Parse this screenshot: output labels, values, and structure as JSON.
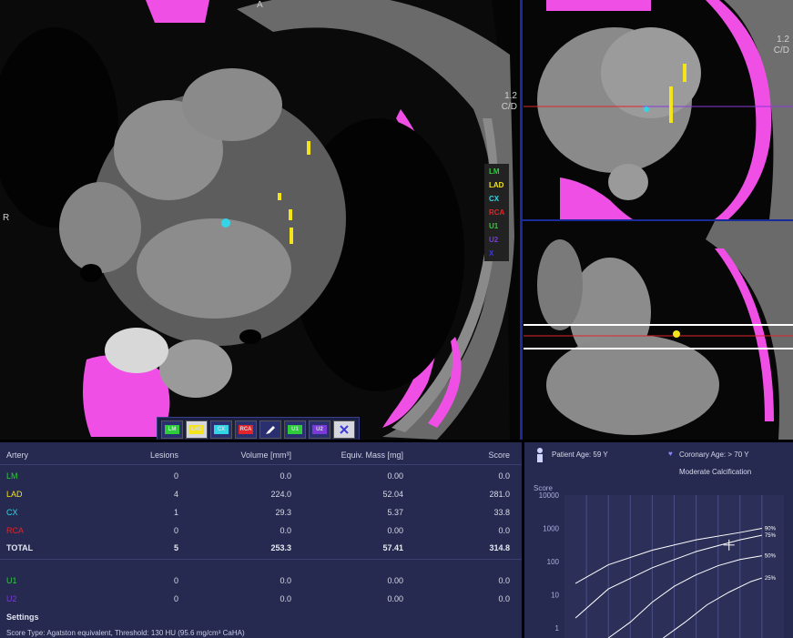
{
  "viewports": {
    "axial": {
      "orientation_left": "R",
      "orientation_top": "A",
      "zoom": "1.2",
      "window": "C/D"
    },
    "sagittal": {
      "zoom": "1.2",
      "window": "C/D"
    }
  },
  "vessel_legend": [
    {
      "label": "LM",
      "color": "#2ecc3a"
    },
    {
      "label": "LAD",
      "color": "#f3e41b"
    },
    {
      "label": "CX",
      "color": "#33d4e6"
    },
    {
      "label": "RCA",
      "color": "#e0262a"
    },
    {
      "label": "U1",
      "color": "#2ecc3a"
    },
    {
      "label": "U2",
      "color": "#7a3ad8"
    },
    {
      "label": "X",
      "color": "#3a3ad8"
    }
  ],
  "toolbar": {
    "buttons": [
      {
        "label": "LM",
        "color": "#2ecc3a",
        "icon": "lm-label-icon"
      },
      {
        "label": "LAD",
        "color": "#f3e41b",
        "icon": "lad-label-icon"
      },
      {
        "label": "CX",
        "color": "#33d4e6",
        "icon": "cx-label-icon"
      },
      {
        "label": "RCA",
        "color": "#e0262a",
        "icon": "rca-label-icon"
      },
      {
        "label": "",
        "color": "#ffffff",
        "icon": "pen-icon"
      },
      {
        "label": "U1",
        "color": "#2ecc3a",
        "icon": "u1-label-icon"
      },
      {
        "label": "U2",
        "color": "#7a3ad8",
        "icon": "u2-label-icon"
      },
      {
        "label": "",
        "color": "#3a3ad8",
        "icon": "delete-x-icon"
      }
    ]
  },
  "table": {
    "headers": {
      "artery": "Artery",
      "lesions": "Lesions",
      "volume": "Volume [mm³]",
      "mass": "Equiv. Mass [mg]",
      "score": "Score"
    },
    "rows": [
      {
        "artery": "LM",
        "color": "#2ecc3a",
        "lesions": "0",
        "volume": "0.0",
        "mass": "0.00",
        "score": "0.0"
      },
      {
        "artery": "LAD",
        "color": "#f3e41b",
        "lesions": "4",
        "volume": "224.0",
        "mass": "52.04",
        "score": "281.0"
      },
      {
        "artery": "CX",
        "color": "#33d4e6",
        "lesions": "1",
        "volume": "29.3",
        "mass": "5.37",
        "score": "33.8"
      },
      {
        "artery": "RCA",
        "color": "#e0262a",
        "lesions": "0",
        "volume": "0.0",
        "mass": "0.00",
        "score": "0.0"
      },
      {
        "artery": "TOTAL",
        "color": "#e6e8f2",
        "lesions": "5",
        "volume": "253.3",
        "mass": "57.41",
        "score": "314.8"
      }
    ],
    "extra_rows": [
      {
        "artery": "U1",
        "color": "#2ecc3a",
        "lesions": "0",
        "volume": "0.0",
        "mass": "0.00",
        "score": "0.0"
      },
      {
        "artery": "U2",
        "color": "#7a3ad8",
        "lesions": "0",
        "volume": "0.0",
        "mass": "0.00",
        "score": "0.0"
      }
    ]
  },
  "settings": {
    "title": "Settings",
    "text": "Score Type: Agatston equivalent, Threshold: 130 HU (95.6 mg/cm³ CaHA)"
  },
  "patient_info": {
    "patient_age": "Patient Age: 59 Y",
    "coronary_age": "Coronary Age: > 70 Y",
    "calcification": "Moderate Calcification"
  },
  "chart_data": {
    "type": "line",
    "ylabel": "Score",
    "yscale": "log",
    "ylim": [
      0.5,
      10000
    ],
    "yticks": [
      "10000",
      "1000",
      "100",
      "10",
      "1"
    ],
    "xlim": [
      0,
      10
    ],
    "series": [
      {
        "name": "90%",
        "points": [
          [
            0.5,
            22
          ],
          [
            2,
            80
          ],
          [
            4,
            220
          ],
          [
            6,
            450
          ],
          [
            8,
            750
          ],
          [
            9,
            1000
          ]
        ]
      },
      {
        "name": "75%",
        "points": [
          [
            0.5,
            2
          ],
          [
            2,
            15
          ],
          [
            4,
            65
          ],
          [
            6,
            200
          ],
          [
            8,
            450
          ],
          [
            9,
            620
          ]
        ]
      },
      {
        "name": "50%",
        "points": [
          [
            2,
            0.5
          ],
          [
            3,
            1.5
          ],
          [
            4,
            6
          ],
          [
            5,
            18
          ],
          [
            6,
            40
          ],
          [
            7,
            75
          ],
          [
            8,
            115
          ],
          [
            9,
            150
          ]
        ]
      },
      {
        "name": "25%",
        "points": [
          [
            4.5,
            0.5
          ],
          [
            5.5,
            1.5
          ],
          [
            6.5,
            5
          ],
          [
            7.5,
            12
          ],
          [
            8.5,
            25
          ],
          [
            9,
            32
          ]
        ]
      }
    ],
    "patient_point": {
      "x": 7.5,
      "y": 314.8
    }
  }
}
